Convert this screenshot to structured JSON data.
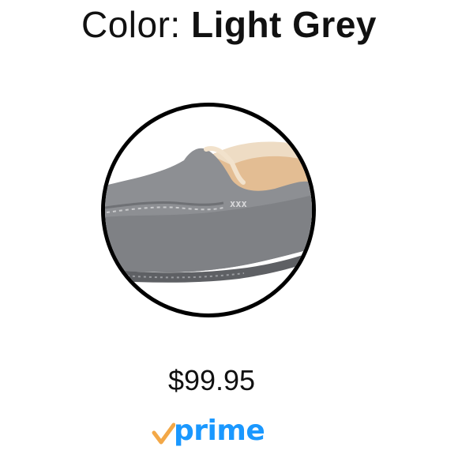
{
  "color_selector": {
    "label": "Color: ",
    "value": "Light Grey",
    "swatch_product": "grey suede moccasin slipper with sheepskin lining"
  },
  "price": "$99.95",
  "prime": {
    "word": "prime",
    "check_color": "#f3a847",
    "word_color": "#1a98ff"
  },
  "colors": {
    "background": "#ffffff",
    "text": "#111111",
    "swatch_border": "#000000",
    "suede": "#8d8f93",
    "lining": "#e2b98e"
  }
}
